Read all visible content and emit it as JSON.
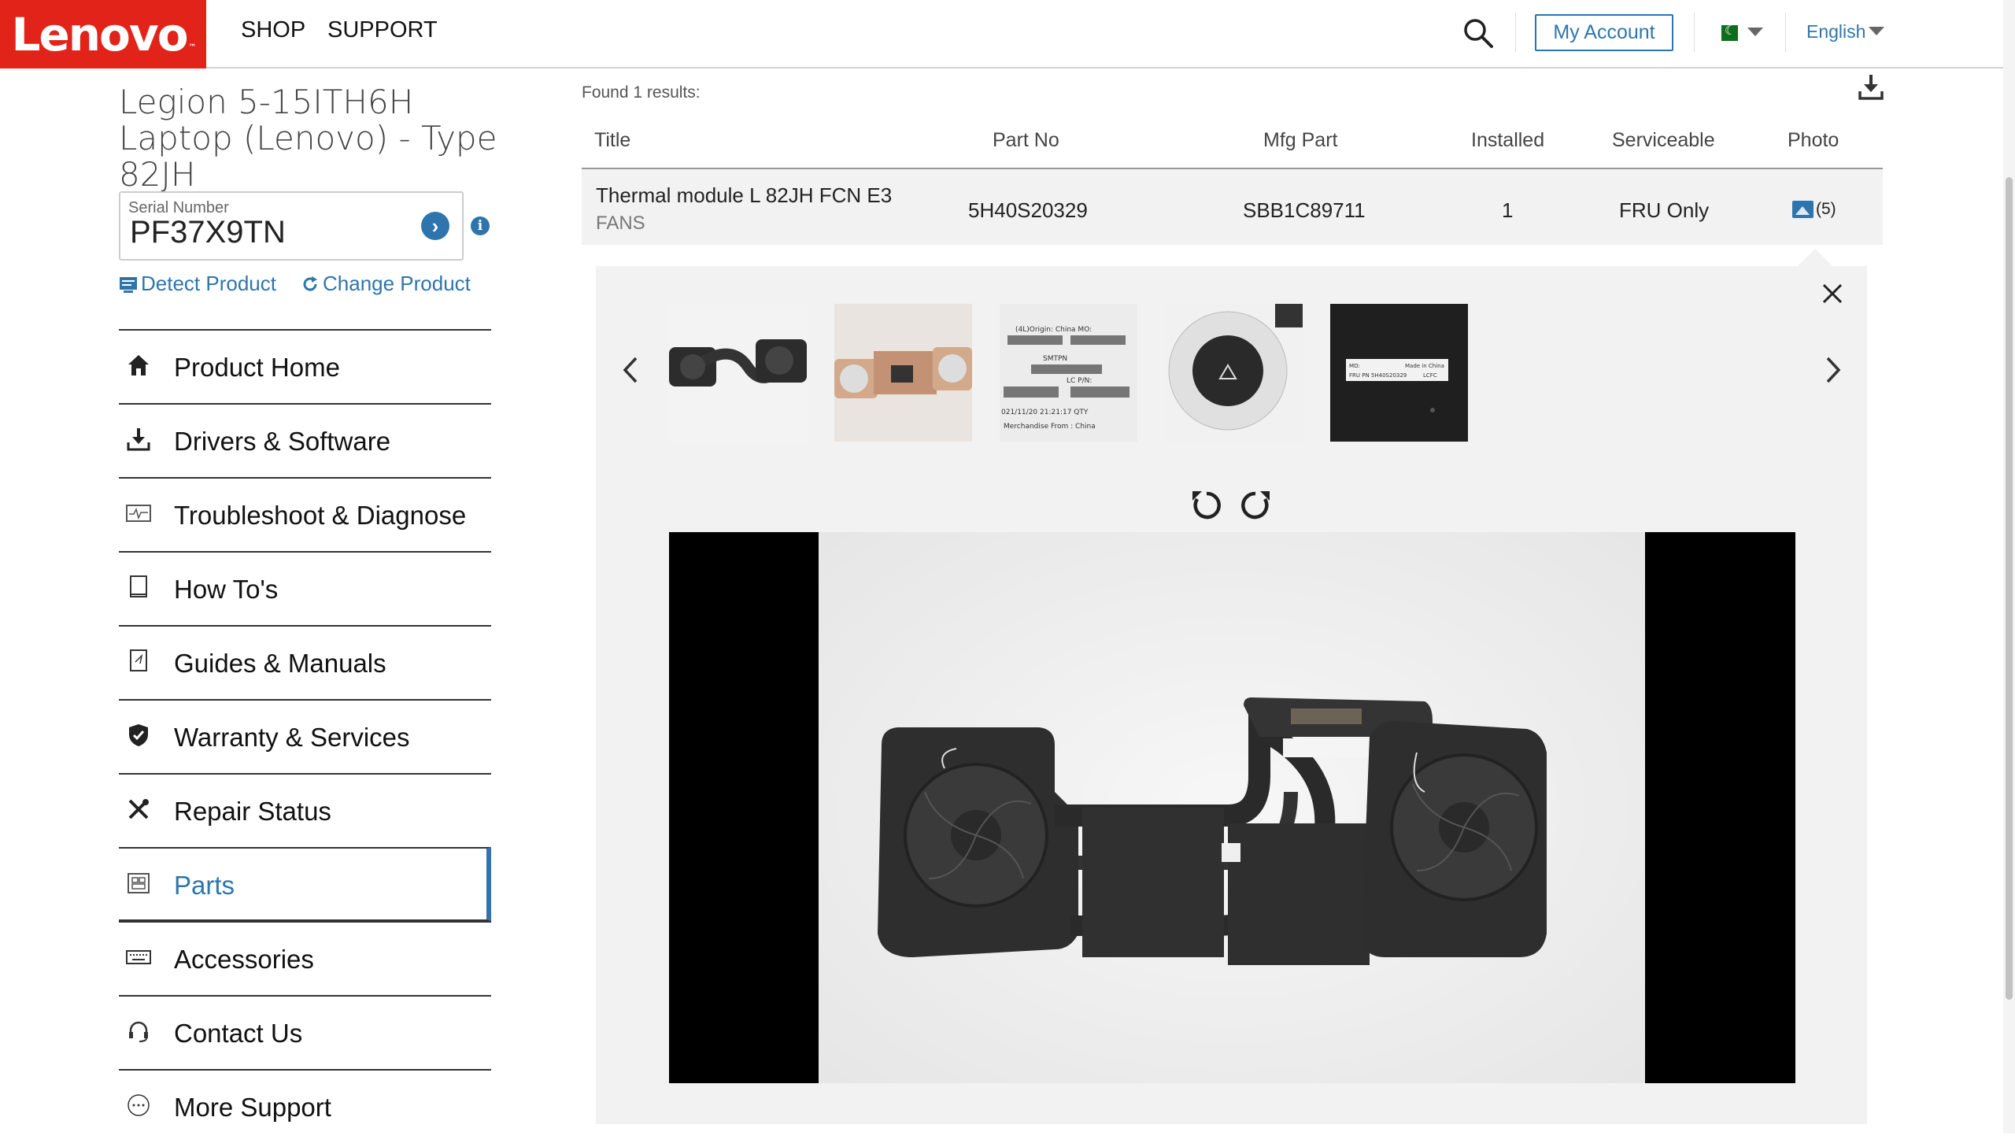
{
  "header": {
    "logo": "Lenovo",
    "logo_mark": "™",
    "nav": [
      "SHOP",
      "SUPPORT"
    ],
    "account_label": "My Account",
    "language": "English"
  },
  "sidebar": {
    "product_title": "Legion 5-15ITH6H Laptop (Lenovo) - Type 82JH",
    "serial_label": "Serial Number",
    "serial_value": "PF37X9TN",
    "detect_label": "Detect Product",
    "change_label": "Change Product",
    "items": [
      {
        "label": "Product Home",
        "icon": "home-icon"
      },
      {
        "label": "Drivers & Software",
        "icon": "download-icon"
      },
      {
        "label": "Troubleshoot & Diagnose",
        "icon": "diagnose-icon"
      },
      {
        "label": "How To's",
        "icon": "book-icon"
      },
      {
        "label": "Guides & Manuals",
        "icon": "manual-icon"
      },
      {
        "label": "Warranty & Services",
        "icon": "shield-icon"
      },
      {
        "label": "Repair Status",
        "icon": "tools-icon"
      },
      {
        "label": "Parts",
        "icon": "parts-icon",
        "active": true
      },
      {
        "label": "Accessories",
        "icon": "keyboard-icon"
      },
      {
        "label": "Contact Us",
        "icon": "headset-icon"
      },
      {
        "label": "More Support",
        "icon": "more-icon"
      }
    ]
  },
  "results": {
    "found_text": "Found 1 results:",
    "columns": [
      "Title",
      "Part No",
      "Mfg Part",
      "Installed",
      "Serviceable",
      "Photo"
    ],
    "rows": [
      {
        "title": "Thermal module L 82JH FCN E3",
        "category": "FANS",
        "part_no": "5H40S20329",
        "mfg_part": "SBB1C89711",
        "installed": "1",
        "serviceable": "FRU Only",
        "photo_count": "(5)"
      }
    ]
  },
  "photo_panel": {
    "thumbnails": [
      "thumb-1",
      "thumb-2",
      "thumb-3",
      "thumb-4",
      "thumb-5"
    ],
    "label_thumb3": [
      "(4L)Origin: China  MO:",
      "SMTPN",
      "LC P/N:",
      "021/11/20 21:21:17  QTY",
      "Merchandise From : China"
    ],
    "label_thumb5": [
      "MO:",
      "FRU PN 5H40S20329",
      "Made in China",
      "LCFC"
    ]
  },
  "colors": {
    "brand_red": "#e2231a",
    "link_blue": "#2e75ad"
  }
}
